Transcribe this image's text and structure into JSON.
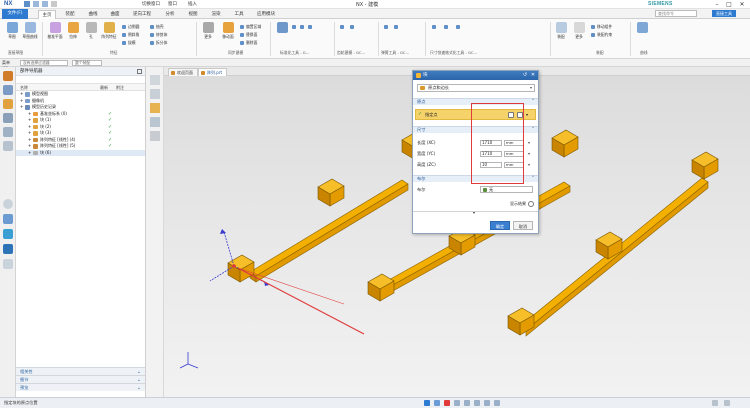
{
  "app": {
    "logo": "NX",
    "title_center": "NX - 建模",
    "brand": "SIEMENS",
    "window_controls": [
      "–",
      "□",
      "✕"
    ],
    "quick_access": {
      "switch_window": "切换窗口",
      "window": "窗口",
      "insert": "插入"
    }
  },
  "tabs": [
    {
      "label": "文件(F)",
      "active": false,
      "file": true
    },
    {
      "label": "主页",
      "active": true
    },
    {
      "label": "装配",
      "active": false
    },
    {
      "label": "曲线",
      "active": false
    },
    {
      "label": "曲面",
      "active": false
    },
    {
      "label": "逆向工程",
      "active": false
    },
    {
      "label": "分析",
      "active": false
    },
    {
      "label": "视图",
      "active": false
    },
    {
      "label": "渲染",
      "active": false
    },
    {
      "label": "工具",
      "active": false
    },
    {
      "label": "应用模块",
      "active": false
    }
  ],
  "top_search": {
    "placeholder": "查找命令"
  },
  "ribbon_right_button": "直接工具",
  "ribbon": {
    "groups": [
      "直接草图",
      "特征",
      "同步建模",
      "标准化工具 - G...",
      "齿轮建模 - GC...",
      "弹簧工具 - GC...",
      "尺寸快速格式化工具 - GC...",
      "装配",
      "曲线"
    ],
    "big_buttons": [
      "草图",
      "草图曲线",
      "基准平面",
      "拉伸",
      "孔",
      "阵列特征",
      "替换面",
      "偏置区域",
      "删除面",
      "更多",
      "移动面",
      "装配",
      "更多"
    ],
    "small_items": [
      "边倒圆",
      "倒斜角",
      "拔模",
      "抽壳",
      "修剪体",
      "拆分体",
      "偏置面",
      "替换面",
      "删除面",
      "移动组件",
      "装配约束"
    ]
  },
  "cmdbar": {
    "menu": "菜单(M) ▾",
    "filter": "没有选择过滤器",
    "scope": "整个装配"
  },
  "navigator": {
    "title": "部件导航器",
    "columns": [
      "名称",
      "最新",
      "附注"
    ],
    "rows": [
      {
        "label": "模型视图",
        "indent": 0,
        "icon": "#7a9cc8",
        "check": ""
      },
      {
        "label": "摄像机",
        "indent": 0,
        "icon": "#7a9cc8",
        "check": ""
      },
      {
        "label": "模型历史记录",
        "indent": 0,
        "icon": "#6a8bb8",
        "check": ""
      },
      {
        "label": "基准坐标系 (0)",
        "indent": 1,
        "icon": "#e89c3a",
        "check": "✓"
      },
      {
        "label": "块 (1)",
        "indent": 1,
        "icon": "#e0a23f",
        "check": "✓"
      },
      {
        "label": "块 (2)",
        "indent": 1,
        "icon": "#e0a23f",
        "check": "✓"
      },
      {
        "label": "块 (3)",
        "indent": 1,
        "icon": "#e0a23f",
        "check": "✓"
      },
      {
        "label": "阵列特征 [线性] (4)",
        "indent": 1,
        "icon": "#c8893a",
        "check": "✓"
      },
      {
        "label": "阵列特征 [线性] (5)",
        "indent": 1,
        "icon": "#c8893a",
        "check": "✓"
      },
      {
        "label": "块 (6)",
        "indent": 1,
        "icon": "#b0b0b0",
        "check": "",
        "selected": true
      }
    ],
    "bottom": [
      "相关性",
      "细节",
      "预览"
    ]
  },
  "doc_tabs": [
    {
      "label": "欢迎页面",
      "active": false
    },
    {
      "label": "阵列.prt",
      "active": true
    }
  ],
  "dialog": {
    "title": "块",
    "type_value": "原点和边长",
    "section_origin": "原点",
    "origin_label": "指定点",
    "section_size": "尺寸",
    "dims": [
      {
        "label": "长度 (XC)",
        "value": "1710",
        "unit": "mm"
      },
      {
        "label": "宽度 (YC)",
        "value": "1710",
        "unit": "mm"
      },
      {
        "label": "高度 (ZC)",
        "value": "10",
        "unit": "mm"
      }
    ],
    "section_bool": "布尔",
    "bool_label": "布尔",
    "bool_value": "无",
    "preview": "显示结果",
    "ok": "确定",
    "cancel": "取消"
  },
  "status": {
    "text": "指定块的原点位置"
  },
  "colors": {
    "accent": "#2c7bd0",
    "bar": "#f2a900",
    "highlight": "#e03a3a",
    "dialog_origin": "#f5d36a"
  }
}
